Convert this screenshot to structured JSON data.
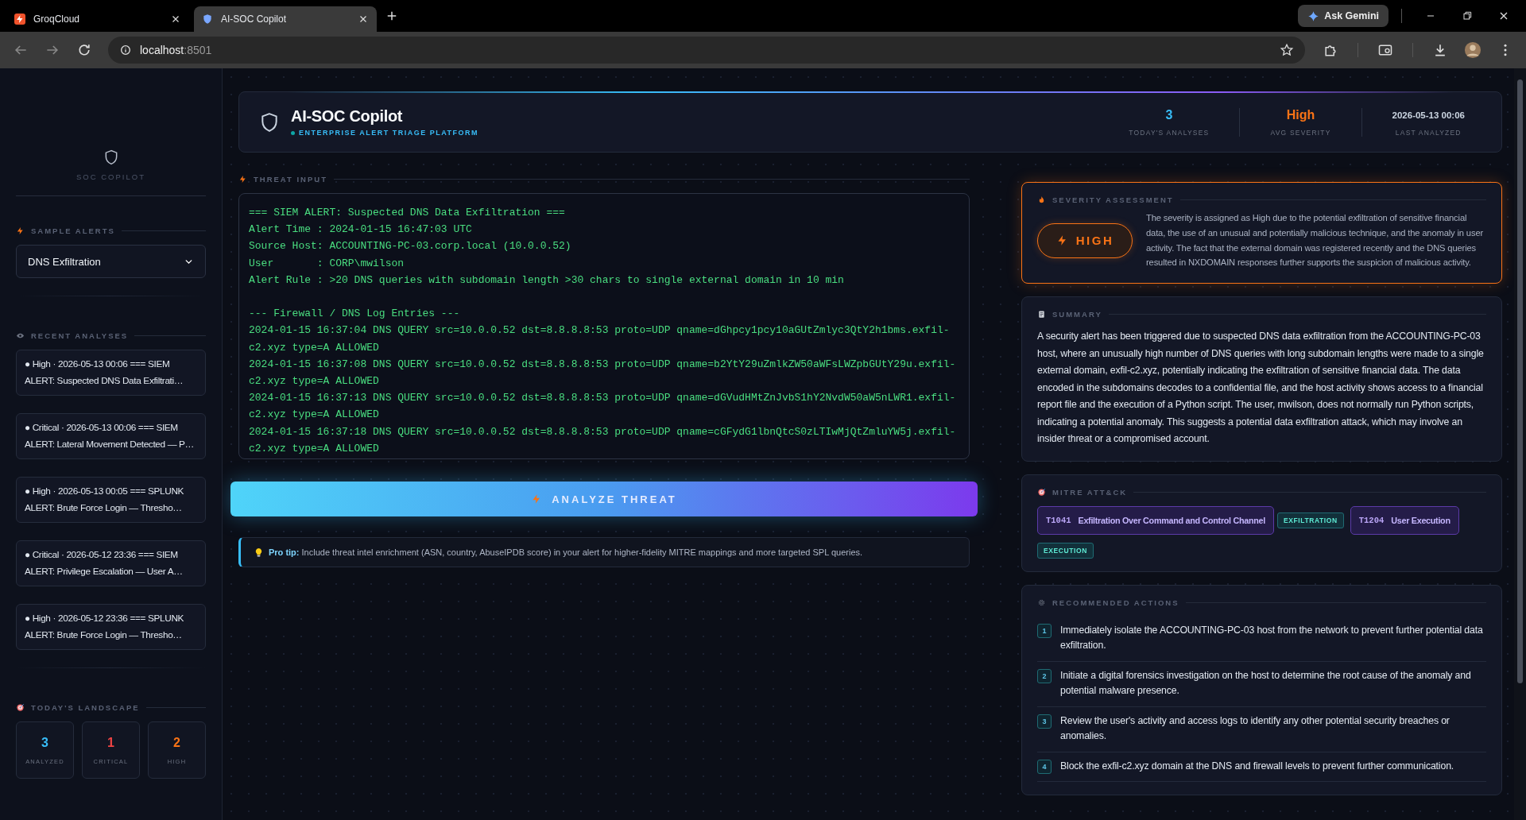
{
  "browser": {
    "tabs": [
      {
        "title": "GroqCloud",
        "selected": false
      },
      {
        "title": "AI-SOC Copilot",
        "selected": true
      }
    ],
    "gemini": "Ask Gemini",
    "address": {
      "host": "localhost",
      "port": ":8501"
    }
  },
  "sidebar": {
    "brand": "SOC COPILOT",
    "sample_alerts": {
      "label": "SAMPLE ALERTS",
      "select": "DNS Exfiltration"
    },
    "recent": {
      "label": "RECENT ANALYSES",
      "items": [
        {
          "text": "● High · 2026-05-13 00:06 === SIEM ALERT: Suspected DNS Data Exfiltrati…"
        },
        {
          "text": "● Critical · 2026-05-13 00:06 === SIEM ALERT: Lateral Movement Detected — P…"
        },
        {
          "text": "● High · 2026-05-13 00:05 === SPLUNK ALERT: Brute Force Login — Thresho…"
        },
        {
          "text": "● Critical · 2026-05-12 23:36 === SIEM ALERT: Privilege Escalation — User A…"
        },
        {
          "text": "● High · 2026-05-12 23:36 === SPLUNK ALERT: Brute Force Login — Thresho…"
        }
      ]
    },
    "landscape": {
      "label": "TODAY'S LANDSCAPE",
      "tiles": [
        {
          "value": "3",
          "label": "ANALYZED",
          "color": "#38bdf8"
        },
        {
          "value": "1",
          "label": "CRITICAL",
          "color": "#ef4444"
        },
        {
          "value": "2",
          "label": "HIGH",
          "color": "#f97316"
        }
      ]
    }
  },
  "header": {
    "title": "AI-SOC Copilot",
    "subtitle": "ENTERPRISE ALERT TRIAGE PLATFORM",
    "stats": [
      {
        "kind": "metric",
        "value": "3",
        "label": "TODAY'S ANALYSES",
        "color": "#38bdf8"
      },
      {
        "kind": "metric",
        "value": "High",
        "label": "AVG SEVERITY",
        "color": "#f97316"
      },
      {
        "kind": "timestamp",
        "value": "2026-05-13 00:06",
        "label": "LAST ANALYZED",
        "color": "#cbd5e1"
      }
    ]
  },
  "threat_input": {
    "label": "THREAT INPUT",
    "text": "=== SIEM ALERT: Suspected DNS Data Exfiltration ===\nAlert Time : 2024-01-15 16:47:03 UTC\nSource Host: ACCOUNTING-PC-03.corp.local (10.0.0.52)\nUser       : CORP\\mwilson\nAlert Rule : >20 DNS queries with subdomain length >30 chars to single external domain in 10 min\n\n--- Firewall / DNS Log Entries ---\n2024-01-15 16:37:04 DNS QUERY src=10.0.0.52 dst=8.8.8.8:53 proto=UDP qname=dGhpcy1pcy10aGUtZmlyc3QtY2h1bms.exfil-c2.xyz type=A ALLOWED\n2024-01-15 16:37:08 DNS QUERY src=10.0.0.52 dst=8.8.8.8:53 proto=UDP qname=b2YtY29uZmlkZW50aWFsLWZpbGUtY29u.exfil-c2.xyz type=A ALLOWED\n2024-01-15 16:37:13 DNS QUERY src=10.0.0.52 dst=8.8.8.8:53 proto=UDP qname=dGVudHMtZnJvbS1hY2NvdW50aW5nLWR1.exfil-c2.xyz type=A ALLOWED\n2024-01-15 16:37:18 DNS QUERY src=10.0.0.52 dst=8.8.8.8:53 proto=UDP qname=cGFydG1lbnQtcS0zLTIwMjQtZmluYW5j.exfil-c2.xyz type=A ALLOWED"
  },
  "analyze_button": "ANALYZE THREAT",
  "pro_tip": "**Pro tip:** Include threat intel enrichment (ASN, country, AbuseIPDB score) in your alert for higher-fidelity MITRE mappings and more targeted SPL queries.",
  "severity": {
    "label": "SEVERITY ASSESSMENT",
    "badge": "HIGH",
    "rationale": "The severity is assigned as High due to the potential exfiltration of sensitive financial data, the use of an unusual and potentially malicious technique, and the anomaly in user activity. The fact that the external domain was registered recently and the DNS queries resulted in NXDOMAIN responses further supports the suspicion of malicious activity."
  },
  "summary": {
    "label": "SUMMARY",
    "text": "A security alert has been triggered due to suspected DNS data exfiltration from the ACCOUNTING-PC-03 host, where an unusually high number of DNS queries with long subdomain lengths were made to a single external domain, exfil-c2.xyz, potentially indicating the exfiltration of sensitive financial data. The data encoded in the subdomains decodes to a confidential file, and the host activity shows access to a financial report file and the execution of a Python script. The user, mwilson, does not normally run Python scripts, indicating a potential anomaly. This suggests a potential data exfiltration attack, which may involve an insider threat or a compromised account."
  },
  "mitre": {
    "label": "MITRE ATT&CK",
    "techniques": [
      {
        "id": "T1041",
        "name": "Exfiltration Over Command and Control Channel",
        "tactic": "EXFILTRATION"
      },
      {
        "id": "T1204",
        "name": "User Execution",
        "tactic": "EXECUTION"
      }
    ]
  },
  "actions": {
    "label": "RECOMMENDED ACTIONS",
    "items": [
      {
        "number": "1",
        "text": "Immediately isolate the ACCOUNTING-PC-03 host from the network to prevent further potential data exfiltration."
      },
      {
        "number": "2",
        "text": "Initiate a digital forensics investigation on the host to determine the root cause of the anomaly and potential malware presence."
      },
      {
        "number": "3",
        "text": "Review the user's activity and access logs to identify any other potential security breaches or anomalies."
      },
      {
        "number": "4",
        "text": "Block the exfil-c2.xyz domain at the DNS and firewall levels to prevent further communication."
      }
    ]
  }
}
